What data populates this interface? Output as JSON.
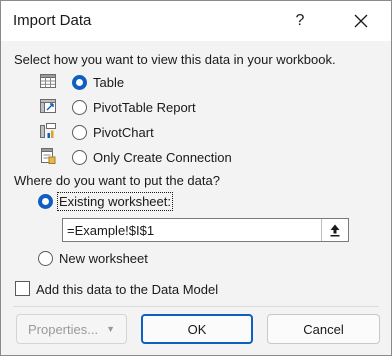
{
  "window": {
    "title": "Import Data",
    "help_glyph": "?"
  },
  "view_section": {
    "prompt": "Select how you want to view this data in your workbook.",
    "options": [
      {
        "label": "Table",
        "checked": true,
        "icon": "table-icon"
      },
      {
        "label": "PivotTable Report",
        "checked": false,
        "icon": "pivottable-icon"
      },
      {
        "label": "PivotChart",
        "checked": false,
        "icon": "pivotchart-icon"
      },
      {
        "label": "Only Create Connection",
        "checked": false,
        "icon": "connection-icon"
      }
    ]
  },
  "location_section": {
    "prompt": "Where do you want to put the data?",
    "existing_label": "Existing worksheet:",
    "existing_checked": true,
    "reference_value": "=Example!$I$1",
    "new_label": "New worksheet",
    "new_checked": false
  },
  "data_model": {
    "label": "Add this data to the Data Model",
    "checked": false
  },
  "buttons": {
    "properties": "Properties...",
    "ok": "OK",
    "cancel": "Cancel"
  },
  "colors": {
    "accent": "#0f5fc2",
    "dialog_bg": "#f3f3f3",
    "titlebar_bg": "#ffffff"
  }
}
